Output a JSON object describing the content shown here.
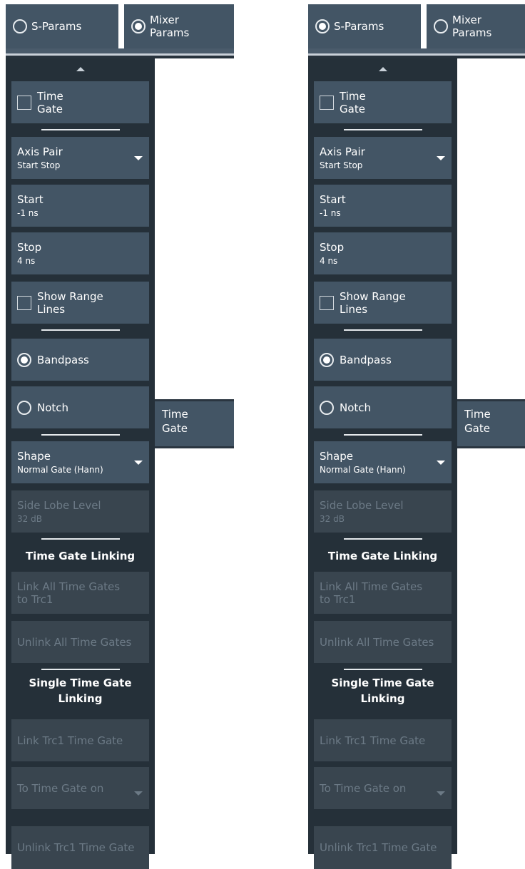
{
  "colors": {
    "panel_bg": "#253039",
    "button_bg": "#435565",
    "disabled_bg": "#39454f",
    "disabled_text": "#6c7a86",
    "text": "#ffffff"
  },
  "left": {
    "topbar": {
      "sparams_label": "S-Params",
      "mixer_label_line1": "Mixer",
      "mixer_label_line2": "Params",
      "selected": "mixer"
    },
    "time_gate_check": {
      "line1": "Time",
      "line2": "Gate",
      "checked": false
    },
    "axis_pair": {
      "label": "Axis Pair",
      "value": "Start Stop"
    },
    "start": {
      "label": "Start",
      "value": "-1 ns"
    },
    "stop": {
      "label": "Stop",
      "value": "4 ns"
    },
    "show_range_lines": {
      "line1": "Show Range",
      "line2": "Lines",
      "checked": false
    },
    "bandpass": {
      "label": "Bandpass",
      "selected": true
    },
    "notch": {
      "label": "Notch",
      "selected": false
    },
    "shape": {
      "label": "Shape",
      "value": "Normal Gate (Hann)"
    },
    "side_lobe": {
      "label": "Side Lobe Level",
      "value": "32 dB"
    },
    "linking_title": "Time Gate Linking",
    "link_all": {
      "line1": "Link All Time Gates",
      "line2": "to Trc1"
    },
    "unlink_all": "Unlink All Time Gates",
    "single_title_line1": "Single Time Gate",
    "single_title_line2": "Linking",
    "link_trc1": "Link Trc1 Time Gate",
    "to_time_gate_on": "To Time Gate on",
    "unlink_trc1": "Unlink Trc1 Time Gate",
    "side_tab": {
      "line1": "Time",
      "line2": "Gate"
    }
  },
  "right": {
    "topbar": {
      "sparams_label": "S-Params",
      "mixer_label_line1": "Mixer",
      "mixer_label_line2": "Params",
      "selected": "sparams"
    },
    "time_gate_check": {
      "line1": "Time",
      "line2": "Gate",
      "checked": false
    },
    "axis_pair": {
      "label": "Axis Pair",
      "value": "Start Stop"
    },
    "start": {
      "label": "Start",
      "value": "-1 ns"
    },
    "stop": {
      "label": "Stop",
      "value": "4 ns"
    },
    "show_range_lines": {
      "line1": "Show Range",
      "line2": "Lines",
      "checked": false
    },
    "bandpass": {
      "label": "Bandpass",
      "selected": true
    },
    "notch": {
      "label": "Notch",
      "selected": false
    },
    "shape": {
      "label": "Shape",
      "value": "Normal Gate (Hann)"
    },
    "side_lobe": {
      "label": "Side Lobe Level",
      "value": "32 dB"
    },
    "linking_title": "Time Gate Linking",
    "link_all": {
      "line1": "Link All Time Gates",
      "line2": "to Trc1"
    },
    "unlink_all": "Unlink All Time Gates",
    "single_title_line1": "Single Time Gate",
    "single_title_line2": "Linking",
    "link_trc1": "Link Trc1 Time Gate",
    "to_time_gate_on": "To Time Gate on",
    "unlink_trc1": "Unlink Trc1 Time Gate",
    "side_tab": {
      "line1": "Time",
      "line2": "Gate"
    }
  }
}
